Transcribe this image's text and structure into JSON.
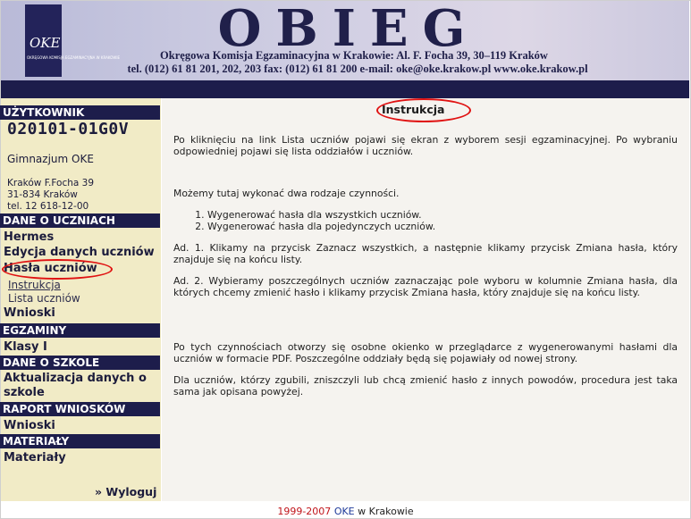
{
  "header": {
    "title": "OBIEG",
    "line1": "Okręgowa Komisja Egzaminacyjna w Krakowie:  Al. F. Focha 39, 30–119 Kraków",
    "line2": "tel. (012) 61 81 201, 202, 203  fax: (012) 61 81 200  e-mail: oke@oke.krakow.pl   www.oke.krakow.pl",
    "logo_mark": "OKE",
    "logo_text": "OKRĘGOWA KOMISJA EGZAMINACYJNA W KRAKOWIE"
  },
  "sidebar": {
    "user_header": "UŻYTKOWNIK",
    "account": "020101-01G0V",
    "school": "Gimnazjum OKE",
    "address": [
      "Kraków F.Focha 39",
      "31-834 Kraków",
      "tel. 12 618-12-00"
    ],
    "students_header": "DANE O UCZNIACH",
    "students_items": [
      "Hermes",
      "Edycja danych uczniów",
      "Hasła uczniów"
    ],
    "students_sub": [
      "Instrukcja",
      "Lista uczniów"
    ],
    "students_last": "Wnioski",
    "exams_header": "EGZAMINY",
    "exams_items": [
      "Klasy I"
    ],
    "school_header": "DANE O SZKOLE",
    "school_items": [
      "Aktualizacja danych o",
      "szkole"
    ],
    "report_header": "RAPORT WNIOSKÓW",
    "report_items": [
      "Wnioski"
    ],
    "materials_header": "MATERIAŁY",
    "materials_items": [
      "Materiały"
    ],
    "logout": "» Wyloguj"
  },
  "content": {
    "title": "Instrukcja",
    "p1": "Po kliknięciu na link Lista uczniów pojawi się ekran z wyborem sesji egzaminacyjnej. Po wybraniu odpowiedniej pojawi się lista oddziałów i uczniów.",
    "p2": "Możemy tutaj wykonać dwa rodzaje czynności.",
    "steps": [
      "Wygenerować hasła dla wszystkich uczniów.",
      "Wygenerować hasła dla pojedynczych uczniów."
    ],
    "p3": "Ad. 1. Klikamy na przycisk Zaznacz wszystkich, a następnie klikamy przycisk Zmiana hasła, który znajduje się na końcu listy.",
    "p4": "Ad. 2. Wybieramy poszczególnych uczniów zaznaczając pole wyboru w kolumnie Zmiana hasła, dla których chcemy zmienić hasło i klikamy przycisk Zmiana hasła, który znajduje się na końcu listy.",
    "p5": "Po tych czynnościach otworzy się osobne okienko w przeglądarce z wygenerowanymi hasłami dla uczniów w formacie PDF. Poszczególne oddziały będą się pojawiały od nowej strony.",
    "p6": "Dla uczniów, którzy zgubili, zniszczyli lub chcą zmienić hasło z innych powodów, procedura jest taka sama jak opisana powyżej."
  },
  "footer": {
    "years": "1999-2007",
    "org": "OKE",
    "rest": " w Krakowie"
  },
  "colors": {
    "navy": "#1d1d4b",
    "sidebar_bg": "#f1ebc6",
    "content_bg": "#f5f3ef",
    "highlight": "#e01212"
  }
}
